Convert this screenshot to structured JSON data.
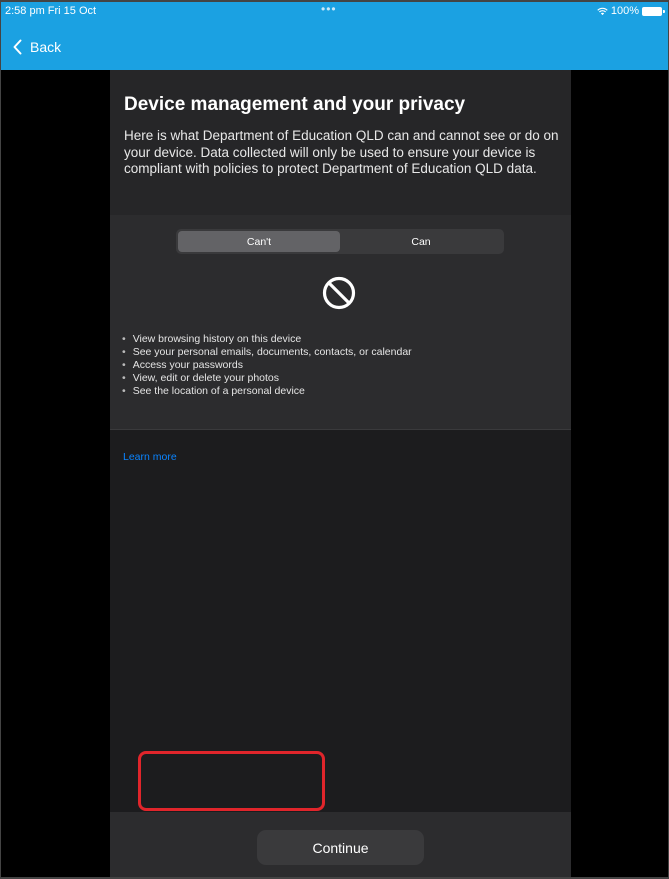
{
  "status_bar": {
    "time": "2:58 pm  Fri 15 Oct",
    "dots": "•••",
    "battery": "100%"
  },
  "nav": {
    "back_label": "Back"
  },
  "content": {
    "title": "Device management and your privacy",
    "description": "Here is what Department of Education QLD can and cannot see or do on your device. Data collected will only be used to ensure your device is compliant with policies to protect Department of Education QLD data.",
    "tabs": [
      {
        "label": "Can't",
        "selected": true
      },
      {
        "label": "Can",
        "selected": false
      }
    ],
    "cant_items": [
      "View browsing history on this device",
      "See your personal emails, documents, contacts, or calendar",
      "Access your passwords",
      "View, edit or delete your photos",
      "See the location of a personal device"
    ],
    "learn_more": "Learn more"
  },
  "footer": {
    "continue_label": "Continue"
  },
  "colors": {
    "nav_bar": "#1ba1e2",
    "panel": "#1c1c1e",
    "link": "#0a84ff",
    "highlight": "#e0252b"
  }
}
